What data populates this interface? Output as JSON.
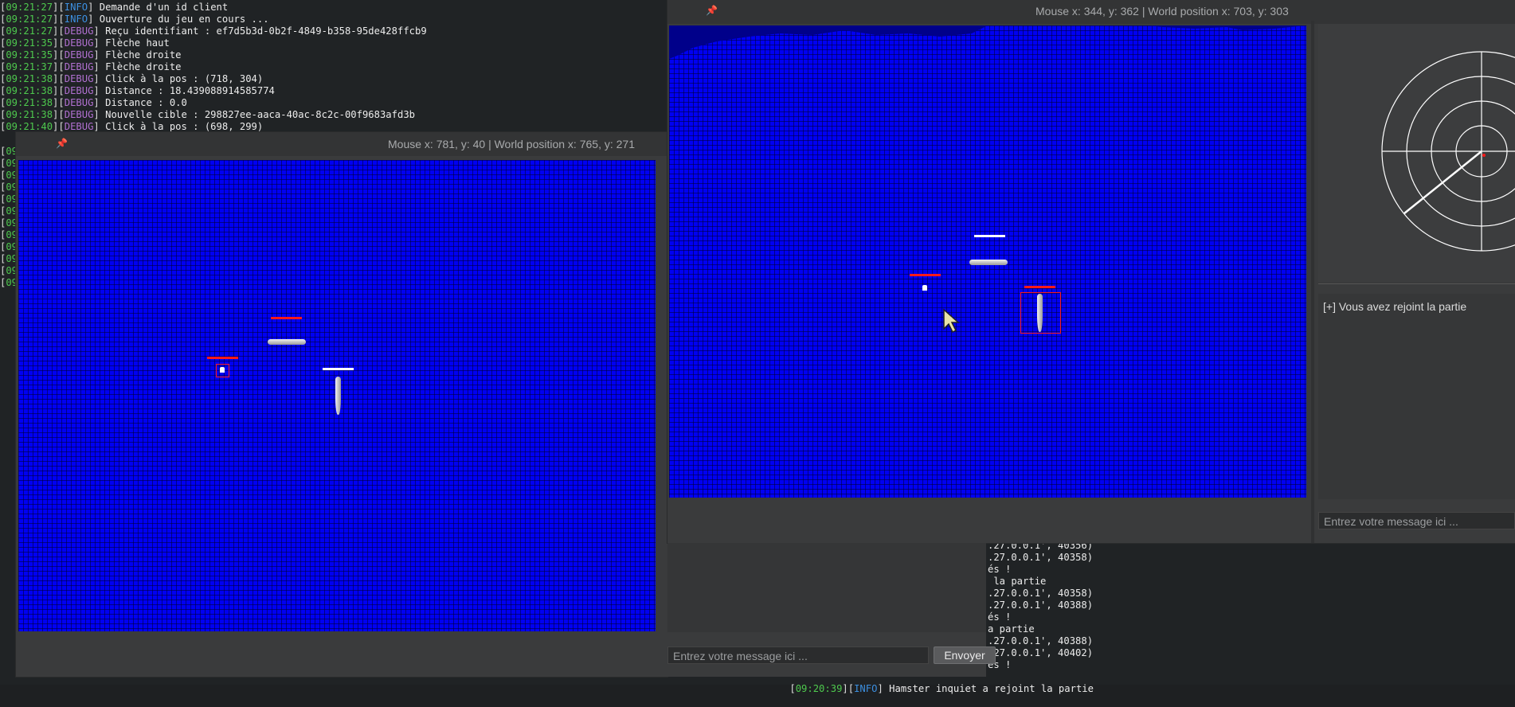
{
  "terminal": {
    "lines": [
      {
        "time": "09:21:27",
        "level": "INFO",
        "msg": "Demande d'un id client"
      },
      {
        "time": "09:21:27",
        "level": "INFO",
        "msg": "Ouverture du jeu en cours ..."
      },
      {
        "time": "09:21:27",
        "level": "DEBUG",
        "msg": "Reçu identifiant : ef7d5b3d-0b2f-4849-b358-95de428ffcb9"
      },
      {
        "time": "09:21:35",
        "level": "DEBUG",
        "msg": "Flèche haut"
      },
      {
        "time": "09:21:35",
        "level": "DEBUG",
        "msg": "Flèche droite"
      },
      {
        "time": "09:21:37",
        "level": "DEBUG",
        "msg": "Flèche droite"
      },
      {
        "time": "09:21:38",
        "level": "DEBUG",
        "msg": "Click à la pos : (718, 304)"
      },
      {
        "time": "09:21:38",
        "level": "DEBUG",
        "msg": "Distance : 18.439088914585774"
      },
      {
        "time": "09:21:38",
        "level": "DEBUG",
        "msg": "Distance : 0.0"
      },
      {
        "time": "09:21:38",
        "level": "DEBUG",
        "msg": "Nouvelle cible : 298827ee-aaca-40ac-8c2c-00f9683afd3b"
      },
      {
        "time": "09:21:40",
        "level": "DEBUG",
        "msg": "Click à la pos : (698, 299)"
      }
    ],
    "stub_prefix": "[09",
    "server_lines": [
      ".27.0.0.1', 40356)",
      ".27.0.0.1', 40358)",
      "és !",
      " la partie",
      ".27.0.0.1', 40358)",
      ".27.0.0.1', 40388)",
      "és !",
      "a partie",
      ".27.0.0.1', 40388)",
      ".27.0.0.1', 40402)",
      "és !"
    ],
    "bottom_line": {
      "time": "09:20:39",
      "level": "INFO",
      "msg": "Hamster inquiet a rejoint la partie"
    }
  },
  "window_left": {
    "status": "Mouse x: 781, y: 40 | World position x: 765, y: 271",
    "chat_placeholder": "Entrez votre message ici ...",
    "send_label": "Envoyer"
  },
  "window_right": {
    "status": "Mouse x: 344, y: 362 | World position x: 703, y: 303",
    "chat_messages": [
      "[+] Vous avez rejoint la partie"
    ],
    "chat_placeholder": "Entrez votre message ici ..."
  },
  "colors": {
    "ocean": "#0000f2",
    "enemy_health": "#ff1a1a",
    "own_health": "#ffffff",
    "selection": "#ff1a1a"
  }
}
